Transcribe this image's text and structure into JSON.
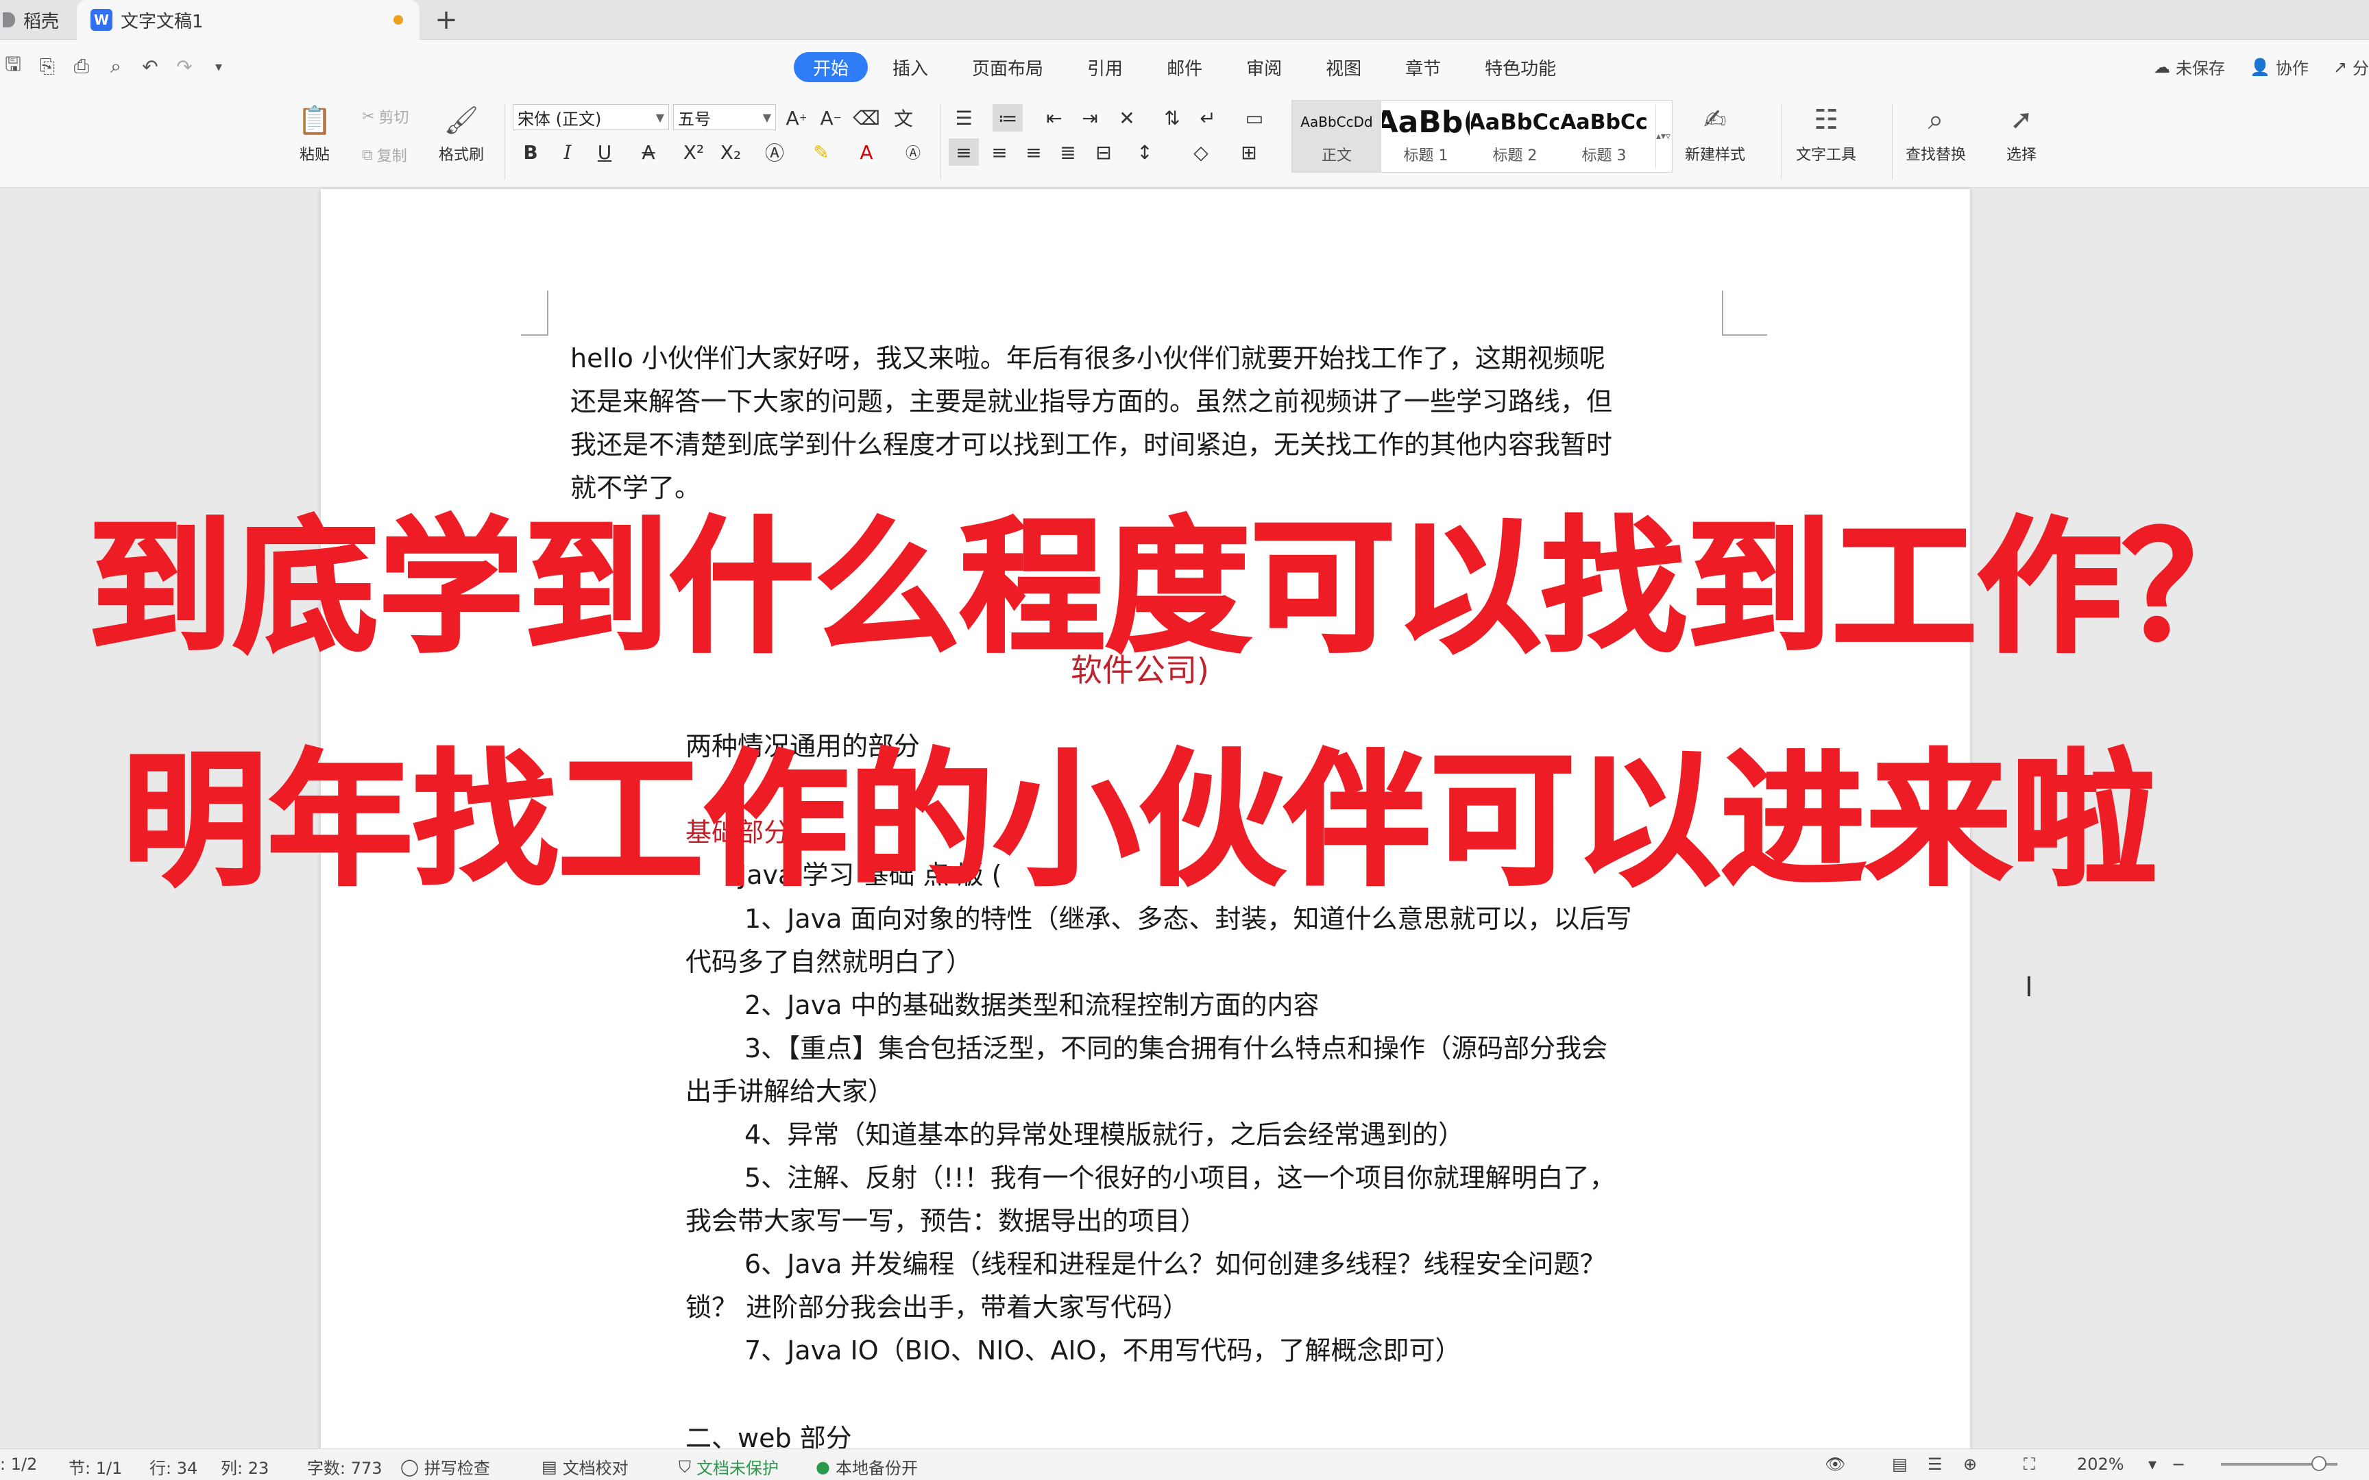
{
  "tabs": {
    "home_label": "稻壳",
    "doc_label": "文字文稿1",
    "new_tab_symbol": "+"
  },
  "menus": {
    "items": [
      "开始",
      "插入",
      "页面布局",
      "引用",
      "邮件",
      "审阅",
      "视图",
      "章节",
      "特色功能"
    ],
    "active": "开始",
    "right": {
      "unsaved": "未保存",
      "collab": "协作",
      "share": "分"
    }
  },
  "ribbon": {
    "paste": "粘贴",
    "cut": "剪切",
    "copy": "复制",
    "format_painter": "格式刷",
    "font_name": "宋体 (正文)",
    "font_size": "五号",
    "styles": [
      {
        "preview": "AaBbCcDd",
        "label": "正文"
      },
      {
        "preview": "AaBb(",
        "label": "标题 1"
      },
      {
        "preview": "AaBbCc",
        "label": "标题 2"
      },
      {
        "preview": "AaBbCc",
        "label": "标题 3"
      }
    ],
    "new_style": "新建样式",
    "text_tools": "文字工具",
    "find_replace": "查找替换",
    "select": "选择"
  },
  "document": {
    "intro_lines": [
      "hello 小伙伴们大家好呀，我又来啦。年后有很多小伙伴们就要开始找工作了，这期视频呢",
      "还是来解答一下大家的问题，主要是就业指导方面的。虽然之前视频讲了一些学习路线，但",
      "我还是不清楚到底学到什么程度才可以找到工作，时间紧迫，无关找工作的其他内容我暂时",
      "就不学了。"
    ],
    "red_subtitle": "软件公司)",
    "partial_line": "两种情况通用的部分",
    "section_heading": "基础部分",
    "partial_java_line": "Java 学习 基础 点 版 (",
    "items": [
      "1、Java 面向对象的特性（继承、多态、封装，知道什么意思就可以，以后写",
      "代码多了自然就明白了）",
      "2、Java 中的基础数据类型和流程控制方面的内容",
      "3、【重点】集合包括泛型，不同的集合拥有什么特点和操作（源码部分我会",
      "出手讲解给大家）",
      "4、异常（知道基本的异常处理模版就行，之后会经常遇到的）",
      "5、注解、反射（!!！我有一个很好的小项目，这一个项目你就理解明白了，",
      "我会带大家写一写，预告：数据导出的项目）",
      "6、Java 并发编程（线程和进程是什么？如何创建多线程？线程安全问题？",
      "锁？ 进阶部分我会出手，带着大家写代码）",
      "7、Java IO（BIO、NIO、AIO，不用写代码，了解概念即可）"
    ],
    "web_heading": "二、web 部分"
  },
  "overlay": {
    "line1": "到底学到什么程度可以找到工作？",
    "line2": "明年找工作的小伙伴可以进来啦"
  },
  "status": {
    "page": ": 1/2",
    "section": "节: 1/1",
    "row": "行: 34",
    "col": "列: 23",
    "words": "字数: 773",
    "spell": "拼写检查",
    "proof": "文档校对",
    "unprotected": "文档未保护",
    "backup": "本地备份开",
    "zoom": "202%"
  },
  "colors": {
    "accent": "#2f7df6",
    "overlay_red": "#ee1c24",
    "doc_red": "#c0202a"
  }
}
